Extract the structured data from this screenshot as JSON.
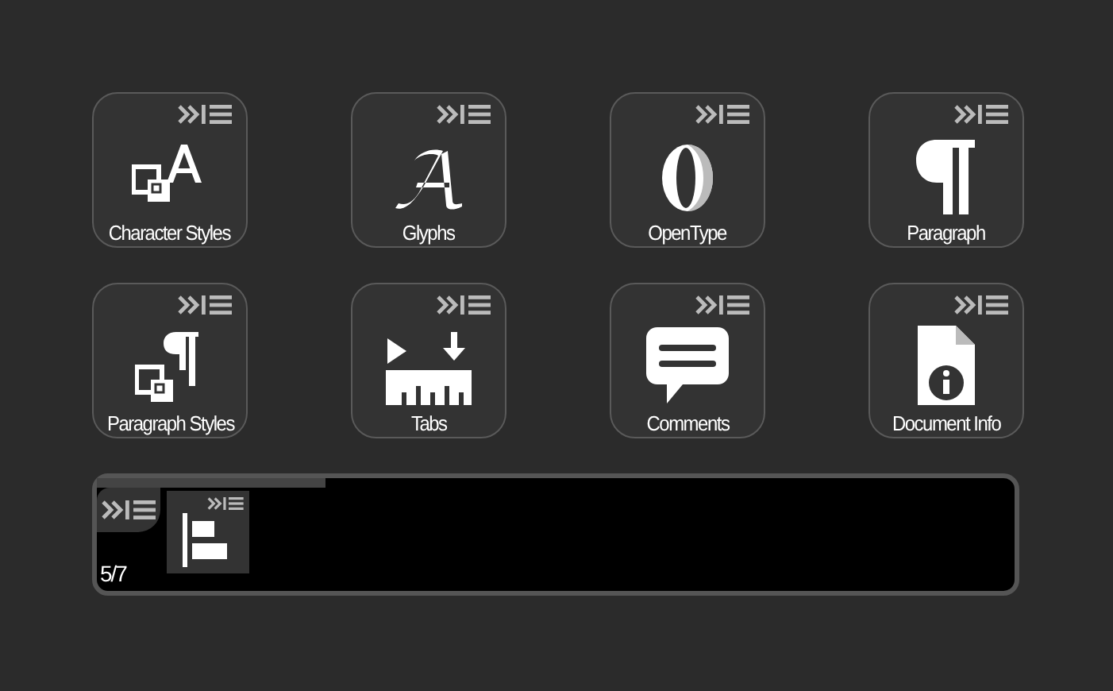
{
  "tiles": [
    {
      "label": "Character Styles",
      "kind": "character-styles"
    },
    {
      "label": "Glyphs",
      "kind": "glyphs"
    },
    {
      "label": "OpenType",
      "kind": "opentype"
    },
    {
      "label": "Paragraph",
      "kind": "paragraph"
    },
    {
      "label": "Paragraph Styles",
      "kind": "paragraph-styles"
    },
    {
      "label": "Tabs",
      "kind": "tabs"
    },
    {
      "label": "Comments",
      "kind": "comments"
    },
    {
      "label": "Document Info",
      "kind": "document-info"
    }
  ],
  "dock": {
    "page": "5/7",
    "items": [
      {
        "kind": "align-left"
      }
    ]
  }
}
